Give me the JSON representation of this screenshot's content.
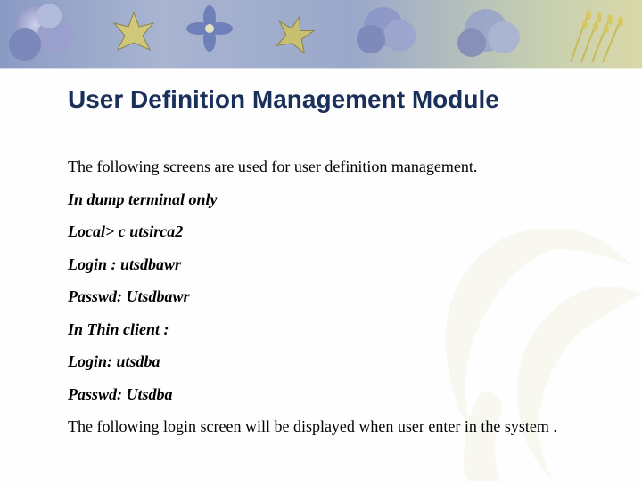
{
  "title": "User Definition Management Module",
  "body": {
    "intro": "The following screens are used for user definition management.",
    "lines": [
      "In dump terminal only",
      "Local> c utsirca2",
      "Login : utsdbawr",
      "Passwd: Utsdbawr",
      "In Thin client :",
      "Login: utsdba",
      "Passwd: Utsdba"
    ],
    "outro": "The following login screen will be displayed when user enter in the system ."
  }
}
